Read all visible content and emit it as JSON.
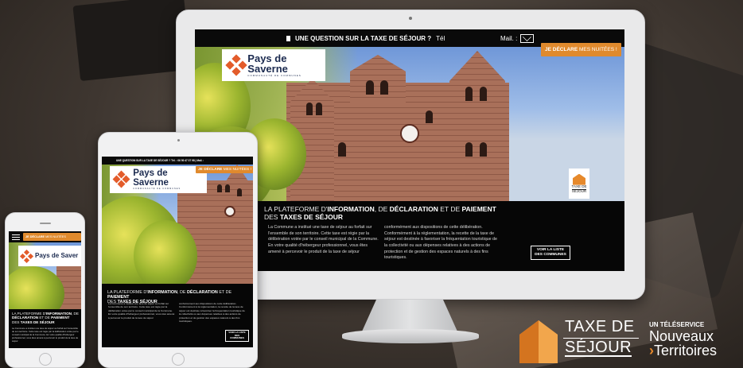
{
  "desktop": {
    "topbar": {
      "question": "UNE QUESTION SUR LA TAXE DE SÉJOUR ?",
      "tel": "Tél",
      "mail": "Mail. :"
    },
    "declare": {
      "bold": "JE DÉCLARE",
      "rest": "MES NUITÉES !"
    },
    "logo": {
      "name": "Pays de Saverne",
      "sub": "COMMUNAUTÉ DE COMMUNES"
    },
    "badge": {
      "line1": "TAXE DE",
      "line2": "SÉJOUR"
    },
    "headline": {
      "p1": "LA PLATEFORME D'",
      "b1": "INFORMATION",
      "p2": ", DE ",
      "b2": "DÉCLARATION",
      "p3": " ET DE ",
      "b3": "PAIEMENT",
      "p4": "DES ",
      "b4": "TAXES DE SÉJOUR"
    },
    "body_left": "La Commune  a institué une taxe de séjour au forfait sur l'ensemble de son territoire. Cette taxe est régie par la délibération votée par le conseil municipal de la Commune. En votre qualité d'hébergeur professionnel, vous êtes amené à percevoir le produit de la taxe de séjour",
    "body_right": "conformément aux dispositions de cette délibération. Conformément à la réglementation, la recette de la taxe de séjour est destinée à favoriser la fréquentation touristique de la collectivité ou aux dépenses relatives à des actions de protection et de gestion des espaces naturels à des fins touristiques.",
    "button": {
      "line1": "VOIR LA LISTE",
      "line2": "DES COMMUNES"
    }
  },
  "tablet": {
    "topbar": "UNE QUESTION SUR LA TAXE DE SÉJOUR ?   Tél. : 06 50 47 37 98   |   Mail. :",
    "declare": {
      "bold": "JE DÉCLARE",
      "rest": "MES NUITÉES !"
    },
    "logo": {
      "name": "Pays de Saverne",
      "sub": "COMMUNAUTÉ DE COMMUNES"
    },
    "headline": {
      "p1": "LA PLATEFORME D'",
      "b1": "INFORMATION",
      "p2": ", DE ",
      "b2": "DÉCLARATION",
      "p3": " ET DE ",
      "b3": "PAIEMENT",
      "p4": "DES ",
      "b4": "TAXES DE SÉJOUR"
    },
    "body_left": "La Commune  a institué une taxe de séjour au forfait sur l'ensemble de son territoire. Cette taxe est régie par la délibération votée par le conseil municipal de la Commune. En votre qualité d'hébergeur professionnel, vous êtes amené à percevoir le produit de la taxe de séjour",
    "body_right": "conformément aux dispositions de cette délibération. Conformément à la réglementation, la recette de la taxe de séjour est destinée à favoriser la fréquentation touristique de la collectivité ou aux dépenses relatives à des actions de protection et de gestion des espaces naturels à des fins touristiques.",
    "button": {
      "line1": "VOIR LA LISTE",
      "line2": "DES COMMUNES"
    }
  },
  "phone": {
    "declare": {
      "bold": "JE DÉCLARE",
      "rest": "MES NUITÉES"
    },
    "logo": {
      "name": "Pays de Saver"
    },
    "headline": {
      "p1": "LA PLATEFORME D'",
      "b1": "INFORMATION",
      "p2": ", DE ",
      "b2": "DÉCLARATION",
      "p3": " ET DE ",
      "b3": "PAIEMENT",
      "p4": "DES ",
      "b4": "TAXES DE SÉJOUR"
    },
    "body": "La Commune a institué une taxe de séjour au forfait sur l'ensemble de son territoire. Cette taxe est régie par la délibération votée par le conseil municipal de la Commune. En votre qualité d'hébergeur professionnel, vous êtes amené à percevoir le produit de la taxe de séjour"
  },
  "brand": {
    "taxe": "TAXE DE",
    "sejour": "SÉJOUR",
    "teleservice": "UN TÉLÉSERVICE",
    "nouveaux": "Nouveaux",
    "territoires": "Territoires"
  },
  "colors": {
    "accent": "#e08a2d",
    "logo_red": "#e35c2b",
    "navy": "#1b2a4f"
  }
}
